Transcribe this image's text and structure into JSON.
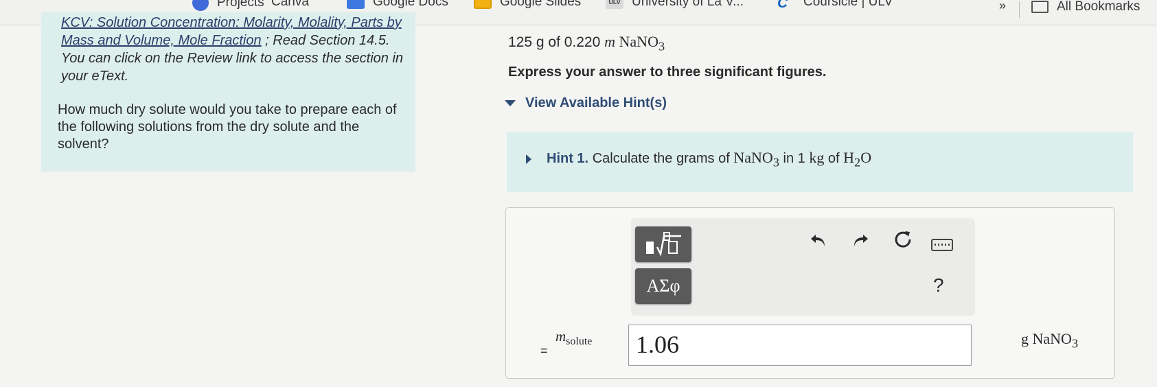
{
  "bookmarks": {
    "items": [
      {
        "label": "Projects",
        "icon": "projects-icon"
      },
      {
        "label": "Canva",
        "icon": "canva-icon"
      },
      {
        "label": "Google Docs",
        "icon": "google-docs-icon"
      },
      {
        "label": "Google Slides",
        "icon": "google-slides-icon"
      },
      {
        "label": "University of La V...",
        "icon": "ulv-icon"
      },
      {
        "label": "Coursicle | ULV",
        "icon": "coursicle-icon"
      }
    ],
    "more": "»",
    "all_label": "All Bookmarks"
  },
  "left": {
    "link_text": "KCV: Solution Concentration: Molarity, Molality, Parts by Mass and Volume, Mole Fraction",
    "link_rest": "; Read Section 14.5. You can click on the Review link to access the section in your eText.",
    "question": "How much dry solute would you take to prepare each of the following solutions from the dry solute and the solvent?"
  },
  "problem": {
    "mass": "125 g of 0.220",
    "unit_m": "m",
    "compound": "NaNO",
    "compound_sub": "3",
    "instruction": "Express your answer to three significant figures.",
    "hint_toggle": "View Available Hint(s)",
    "hint1_label": "Hint 1.",
    "hint1_text": "Calculate the grams of",
    "hint1_in": "in 1",
    "hint1_kg": "kg",
    "hint1_of": "of",
    "water": "H",
    "water_sub": "2",
    "water_o": "O"
  },
  "answer": {
    "greek_label": "ΑΣφ",
    "help": "?",
    "var": "m",
    "var_sub": "solute",
    "eq": "=",
    "value": "1.06",
    "unit": "g NaNO",
    "unit_sub": "3"
  }
}
